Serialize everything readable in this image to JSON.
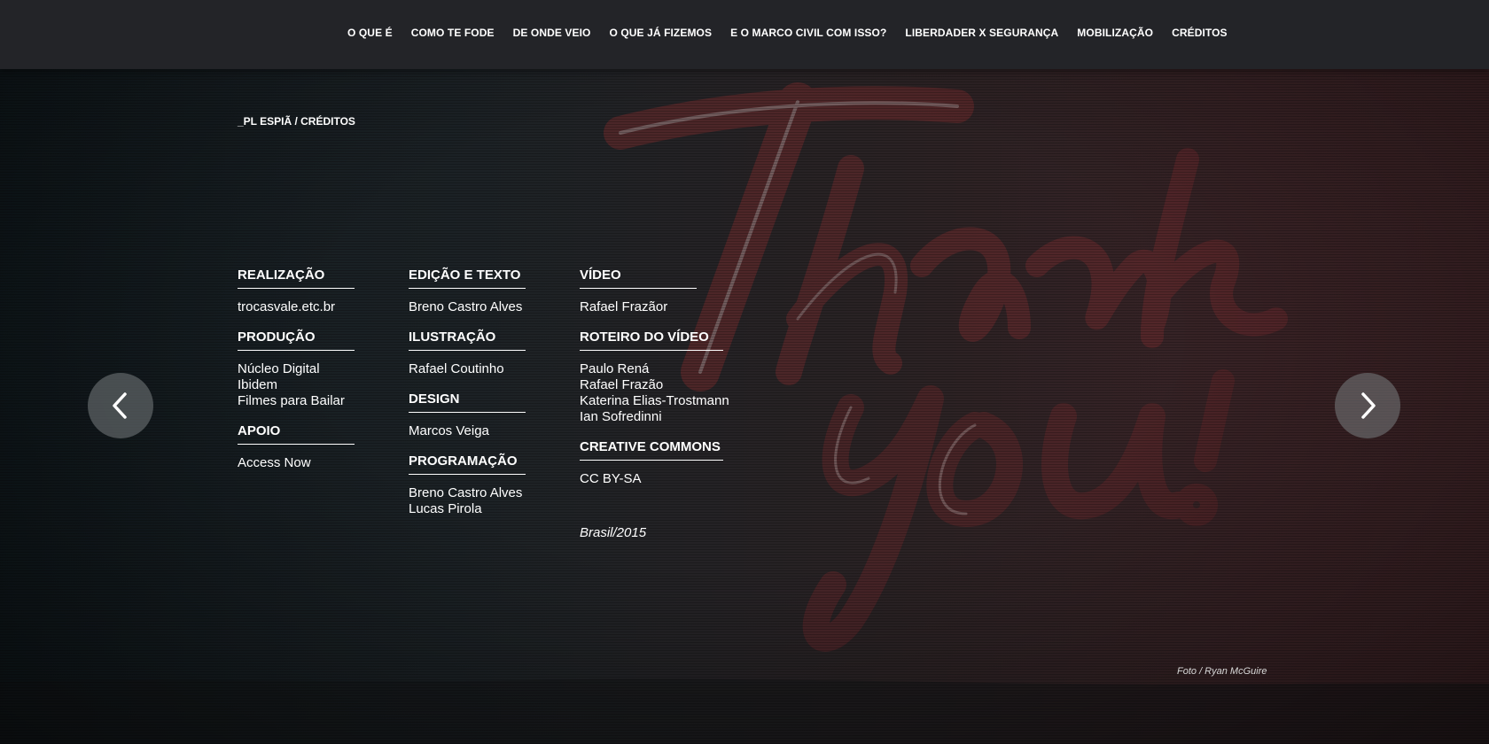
{
  "nav": {
    "items": [
      {
        "label": "O QUE É"
      },
      {
        "label": "COMO TE FODE"
      },
      {
        "label": "DE ONDE VEIO"
      },
      {
        "label": "O QUE JÁ FIZEMOS"
      },
      {
        "label": "E O MARCO CIVIL COM ISSO?"
      },
      {
        "label": "LIBERDADER X SEGURANÇA"
      },
      {
        "label": "MOBILIZAÇÃO"
      },
      {
        "label": "CRÉDITOS"
      }
    ]
  },
  "breadcrumb": "_PL ESPIÃ / CRÉDITOS",
  "credits": {
    "col1": [
      {
        "title": "REALIZAÇÃO",
        "names": [
          "trocasvale.etc.br"
        ]
      },
      {
        "title": "PRODUÇÃO",
        "names": [
          "Núcleo Digital",
          "Ibidem",
          "Filmes para Bailar"
        ]
      },
      {
        "title": "APOIO",
        "names": [
          "Access Now"
        ]
      }
    ],
    "col2": [
      {
        "title": "EDIÇÃO E TEXTO",
        "names": [
          "Breno Castro Alves"
        ]
      },
      {
        "title": "ILUSTRAÇÃO",
        "names": [
          "Rafael Coutinho"
        ]
      },
      {
        "title": "DESIGN",
        "names": [
          "Marcos Veiga"
        ]
      },
      {
        "title": "PROGRAMAÇÃO",
        "names": [
          "Breno Castro Alves",
          "Lucas Pirola"
        ]
      }
    ],
    "col3": [
      {
        "title": "VÍDEO",
        "names": [
          "Rafael Frazãor"
        ]
      },
      {
        "title": "ROTEIRO DO VÍDEO",
        "names": [
          "Paulo Rená",
          "Rafael Frazão",
          "Katerina Elias-Trostmann",
          "Ian Sofredinni"
        ]
      },
      {
        "title": "CREATIVE COMMONS",
        "names": [
          "CC BY-SA"
        ]
      }
    ],
    "country": "Brasil/2015"
  },
  "photo_credit": "Foto / Ryan McGuire",
  "colors": {
    "nav_bg": "#232428",
    "text": "#ffffff",
    "arrow_bg": "#787e80"
  },
  "icons": {
    "prev": "chevron-left-icon",
    "next": "chevron-right-icon"
  }
}
